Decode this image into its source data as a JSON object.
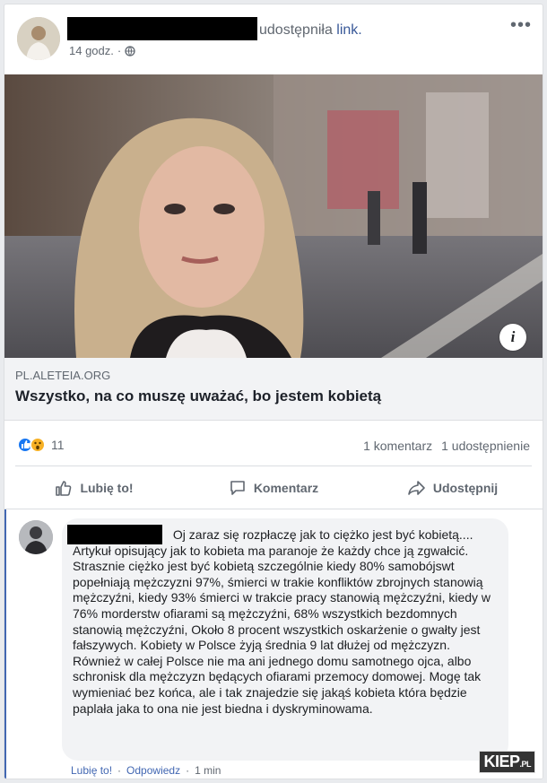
{
  "post": {
    "shared_text": "udostępniła",
    "link_word": "link.",
    "time": "14 godz.",
    "privacy_icon": "globe-icon",
    "more_icon": "ellipsis-icon"
  },
  "link": {
    "domain": "PL.ALETEIA.ORG",
    "title": "Wszystko, na co muszę uważać, bo jestem kobietą",
    "info_label": "i"
  },
  "stats": {
    "reactions_count": "11",
    "comments": "1 komentarz",
    "shares": "1 udostępnienie"
  },
  "actions": [
    {
      "label": "Lubię to!",
      "icon": "thumbs-up-icon"
    },
    {
      "label": "Komentarz",
      "icon": "comment-icon"
    },
    {
      "label": "Udostępnij",
      "icon": "share-icon"
    }
  ],
  "comment": {
    "text": "Oj zaraz się rozpłaczę jak to ciężko jest być kobietą.... Artykuł opisujący jak to kobieta ma paranoje że każdy chce ją zgwałcić. Strasznie ciężko jest być kobietą szczególnie kiedy 80% samobójswt popełniają mężczyzni 97%, śmierci w trakie konfliktów zbrojnych stanowią mężczyźni, kiedy 93% śmierci w trakcie pracy stanowią mężczyźni, kiedy w 76% morderstw ofiarami są mężczyźni, 68% wszystkich bezdomnych stanowią mężczyźni, Około 8 procent wszystkich oskarżenie o gwałty jest fałszywych. Kobiety w Polsce żyją średnia 9 lat dłużej od mężczyzn. Również w całej Polsce nie ma ani jednego domu samotnego ojca, albo schronisk dla mężczyzn będących ofiarami przemocy domowej. Mogę tak wymieniać bez końca, ale i tak znajedzie się jakąś kobieta która będzie paplała jaka to ona nie jest biedna i dyskryminowama.",
    "like": "Lubię to!",
    "reply": "Odpowiedz",
    "sep": "·",
    "time": "1 min"
  },
  "watermark": {
    "main": "KIEP",
    "suffix": ".PL"
  }
}
